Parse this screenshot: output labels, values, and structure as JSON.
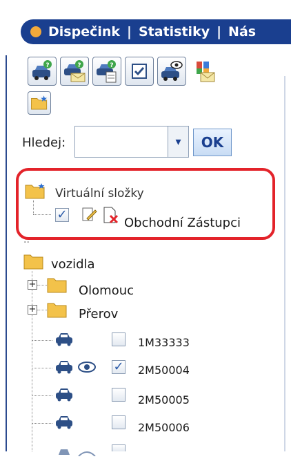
{
  "nav": {
    "items": [
      "Dispečink",
      "Statistiky",
      "Nás"
    ],
    "separator": "|"
  },
  "toolbar": {
    "icons": [
      "car-question-icon",
      "car-mail-question-icon",
      "car-document-question-icon",
      "checkbox-icon",
      "car-eye-icon",
      "group-mail-icon"
    ],
    "new_folder_icon": "folder-new-icon"
  },
  "search": {
    "label": "Hledej:",
    "value": "",
    "ok_label": "OK",
    "dropdown_glyph": "▾"
  },
  "virtual_folders": {
    "label": "Virtuální složky",
    "item_label": "Obchodní Zástupci",
    "item_checked": true
  },
  "tree": {
    "root_label": "vozidla",
    "groups": [
      "Olomouc",
      "Přerov"
    ],
    "vehicles": [
      {
        "id": "1M33333",
        "checked": false,
        "watched": false
      },
      {
        "id": "2M50004",
        "checked": true,
        "watched": true
      },
      {
        "id": "2M50005",
        "checked": false,
        "watched": false
      },
      {
        "id": "2M50006",
        "checked": false,
        "watched": false
      }
    ]
  },
  "colors": {
    "nav_bg": "#1a3f8f",
    "nav_dot": "#f2a93b",
    "highlight": "#e3232a",
    "folder": "#f3c24a"
  }
}
